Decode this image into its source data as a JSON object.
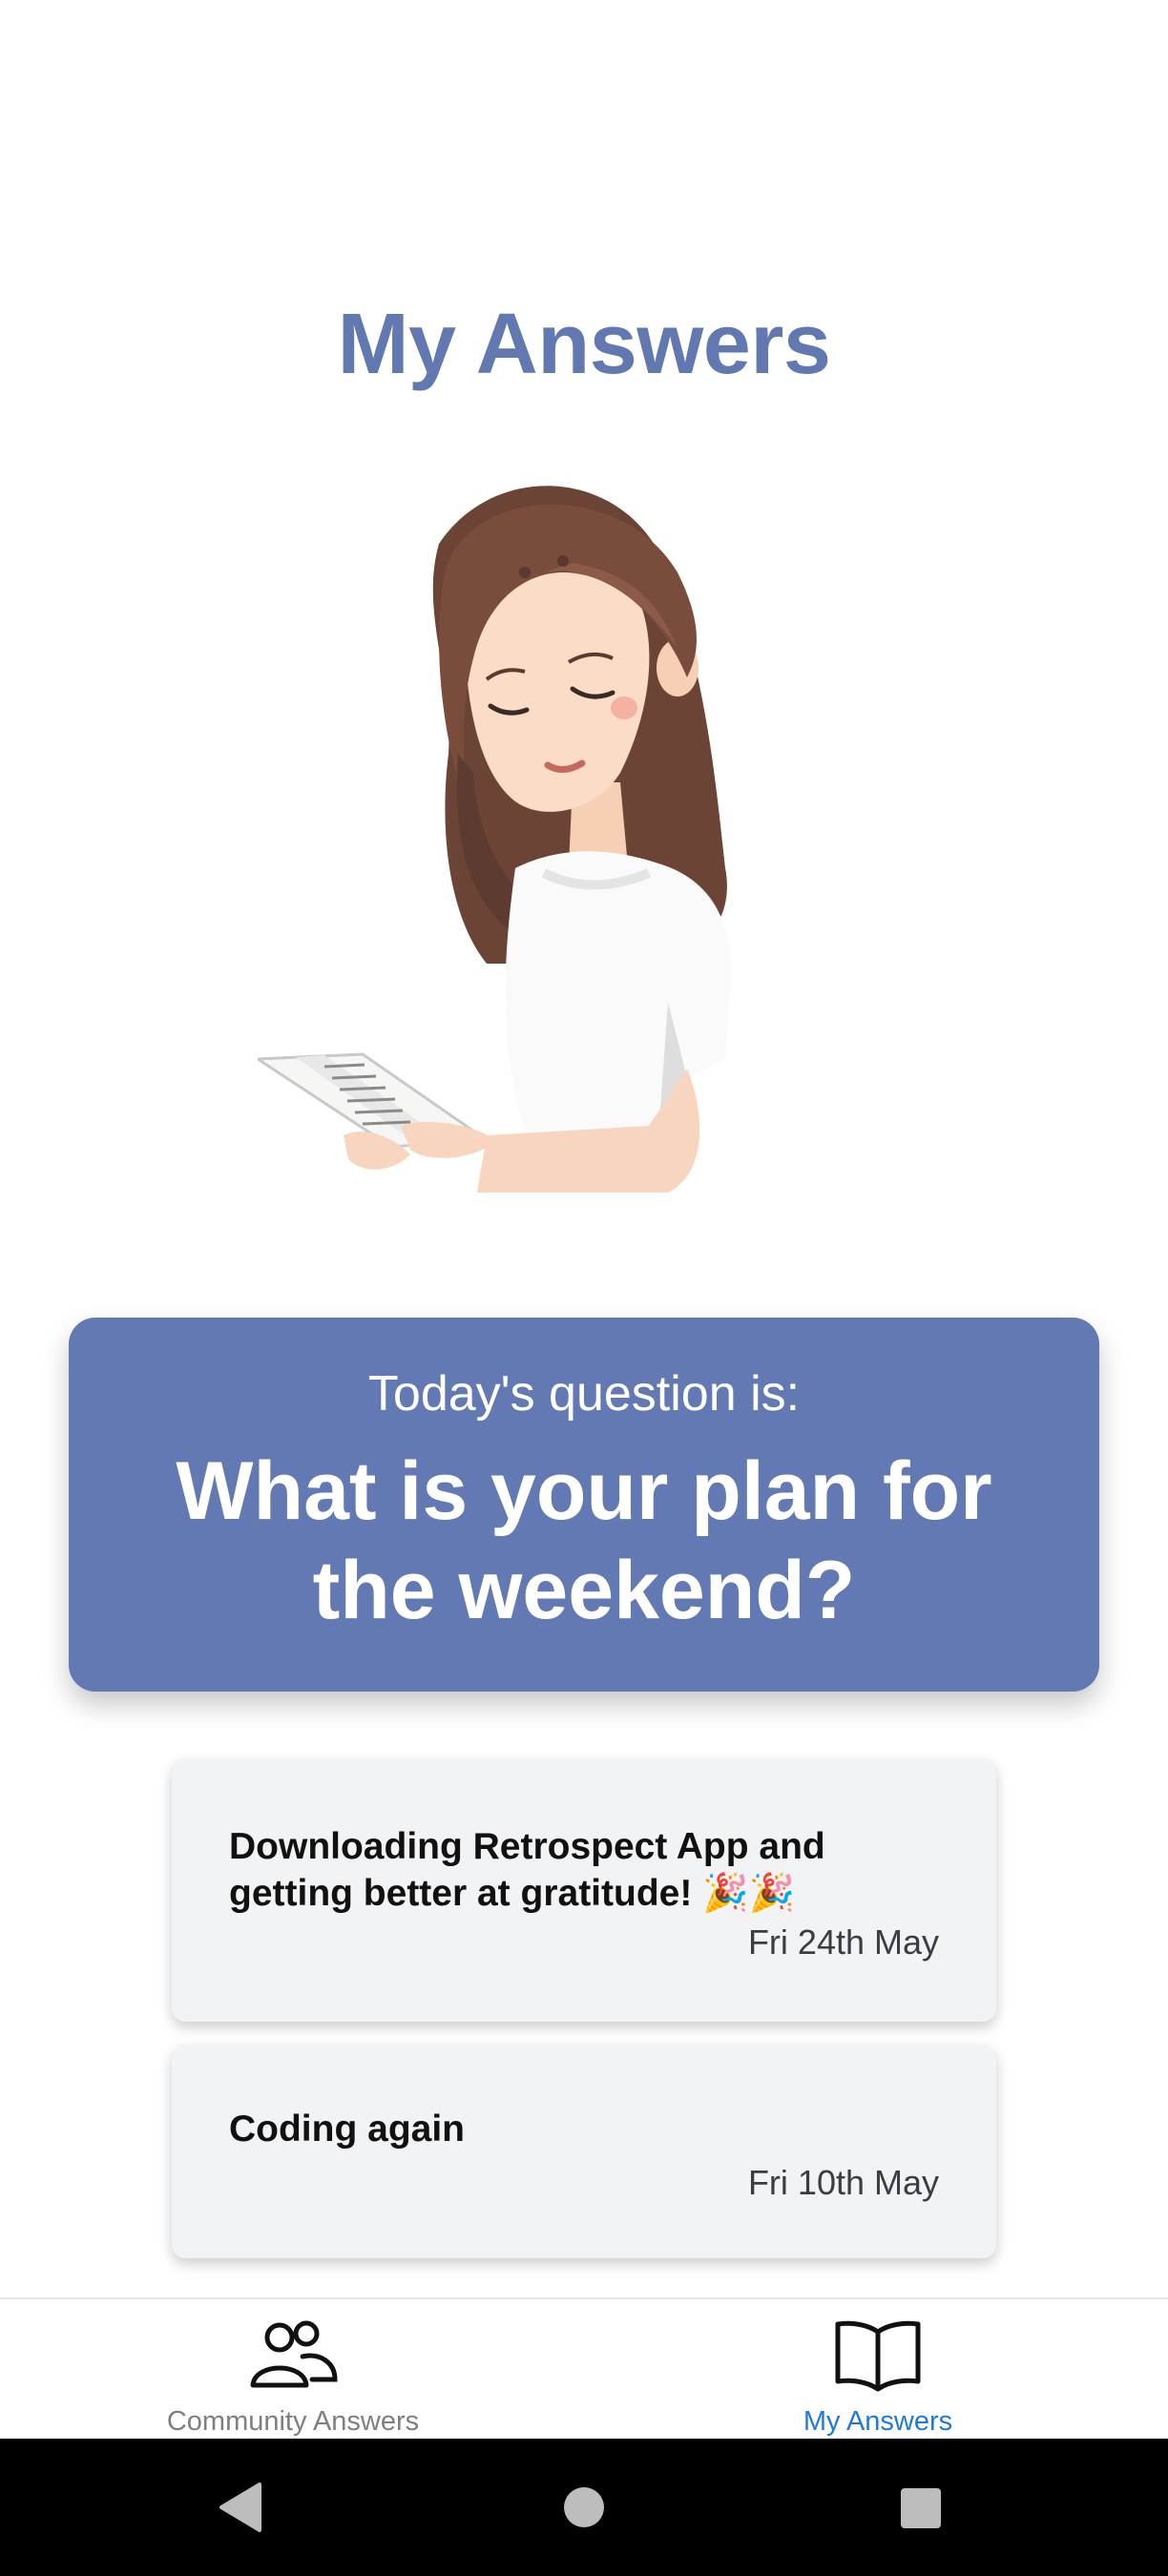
{
  "header": {
    "title": "My Answers"
  },
  "question": {
    "intro": "Today's question is:",
    "text": "What is your plan for the weekend?"
  },
  "answers": [
    {
      "text": "Downloading Retrospect App and getting better at gratitude! 🎉🎉",
      "date": "Fri 24th May"
    },
    {
      "text": "Coding again",
      "date": "Fri 10th May"
    }
  ],
  "bottom_nav": {
    "items": [
      {
        "label": "Community Answers",
        "icon": "people-icon",
        "active": false
      },
      {
        "label": "My Answers",
        "icon": "open-book-icon",
        "active": true
      }
    ]
  },
  "colors": {
    "title": "#6278b1",
    "question_card": "#6379b3",
    "answer_card": "#f2f3f5",
    "active_nav": "#1f7ae0",
    "inactive_nav": "#7f7f7f"
  },
  "illustration": "woman-reading-book-illustration",
  "system_nav": [
    "back-icon",
    "home-icon",
    "recent-apps-icon"
  ]
}
